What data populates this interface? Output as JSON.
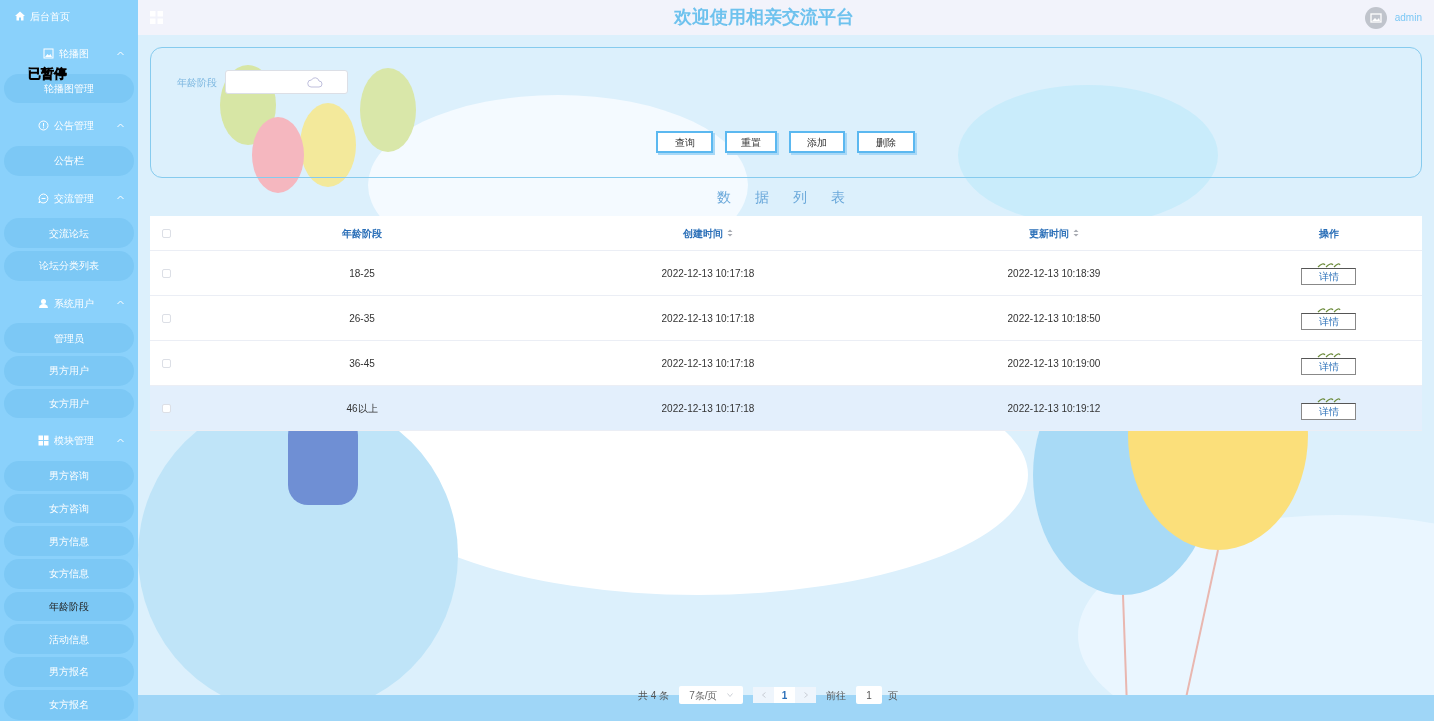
{
  "sidebar": {
    "home": "后台首页",
    "groups": [
      {
        "title": "轮播图",
        "expanded": true,
        "items": [
          {
            "label": "轮播图管理",
            "selected": false
          }
        ]
      },
      {
        "title": "公告管理",
        "expanded": true,
        "items": [
          {
            "label": "公告栏",
            "selected": false
          }
        ]
      },
      {
        "title": "交流管理",
        "expanded": true,
        "items": [
          {
            "label": "交流论坛",
            "selected": false
          },
          {
            "label": "论坛分类列表",
            "selected": false
          }
        ]
      },
      {
        "title": "系统用户",
        "expanded": true,
        "items": [
          {
            "label": "管理员",
            "selected": false
          },
          {
            "label": "男方用户",
            "selected": false
          },
          {
            "label": "女方用户",
            "selected": false
          }
        ]
      },
      {
        "title": "模块管理",
        "expanded": true,
        "items": [
          {
            "label": "男方咨询",
            "selected": false
          },
          {
            "label": "女方咨询",
            "selected": false
          },
          {
            "label": "男方信息",
            "selected": false
          },
          {
            "label": "女方信息",
            "selected": false
          },
          {
            "label": "年龄阶段",
            "selected": true
          },
          {
            "label": "活动信息",
            "selected": false
          },
          {
            "label": "男方报名",
            "selected": false
          },
          {
            "label": "女方报名",
            "selected": false
          }
        ]
      }
    ]
  },
  "overlay": "已暂停",
  "header": {
    "title": "欢迎使用相亲交流平台",
    "user": "admin"
  },
  "search": {
    "label": "年龄阶段",
    "buttons": [
      "查询",
      "重置",
      "添加",
      "删除"
    ]
  },
  "list_title": "数 据 列 表",
  "table": {
    "header_checked": false,
    "columns": [
      {
        "label": "年龄阶段",
        "sortable": false
      },
      {
        "label": "创建时间",
        "sortable": true
      },
      {
        "label": "更新时间",
        "sortable": true
      },
      {
        "label": "操作",
        "sortable": false
      }
    ],
    "rows": [
      {
        "checked": false,
        "highlighted": false,
        "cells": [
          "18-25",
          "2022-12-13 10:17:18",
          "2022-12-13 10:18:39"
        ],
        "action": "详情"
      },
      {
        "checked": false,
        "highlighted": false,
        "cells": [
          "26-35",
          "2022-12-13 10:17:18",
          "2022-12-13 10:18:50"
        ],
        "action": "详情"
      },
      {
        "checked": false,
        "highlighted": false,
        "cells": [
          "36-45",
          "2022-12-13 10:17:18",
          "2022-12-13 10:19:00"
        ],
        "action": "详情"
      },
      {
        "checked": false,
        "highlighted": true,
        "cells": [
          "46以上",
          "2022-12-13 10:17:18",
          "2022-12-13 10:19:12"
        ],
        "action": "详情"
      }
    ]
  },
  "pagination": {
    "total": "共 4 条",
    "page_size": "7条/页",
    "current": "1",
    "goto_label": "前往",
    "goto_value": "1",
    "page_unit": "页"
  }
}
